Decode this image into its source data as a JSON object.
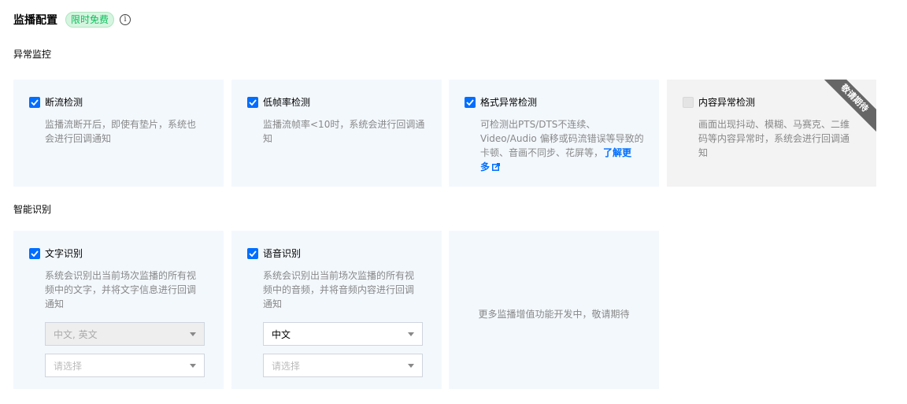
{
  "header": {
    "title": "监播配置",
    "badge": "限时免费",
    "info_symbol": "i"
  },
  "sections": {
    "abnormal": "异常监控",
    "smart": "智能识别"
  },
  "cards": {
    "stream_cut": {
      "label": "断流检测",
      "checked": true,
      "desc": [
        "监播流断开后，即使有垫片，系统也",
        "会进行回调通知"
      ]
    },
    "low_fps": {
      "label": "低帧率检测",
      "checked": true,
      "desc": [
        "监播流帧率<10时，系统会进行回调通",
        "知"
      ]
    },
    "format": {
      "label": "格式异常检测",
      "checked": true,
      "desc": [
        "可检测出PTS/DTS不连续、",
        "Video/Audio 偏移或码流错误等导致的",
        "卡顿、音画不同步、花屏等，"
      ],
      "link_1": "了解更",
      "link_2": "多"
    },
    "content": {
      "label": "内容异常检测",
      "checked": false,
      "desc": [
        "画面出现抖动、模糊、马赛克、二维",
        "码等内容异常时，系统会进行回调通",
        "知"
      ],
      "ribbon": "敬请期待"
    },
    "text_ocr": {
      "label": "文字识别",
      "checked": true,
      "desc": [
        "系统会识别出当前场次监播的所有视",
        "频中的文字，并将文字信息进行回调",
        "通知"
      ],
      "select_1": "中文, 英文",
      "select_2_placeholder": "请选择"
    },
    "speech": {
      "label": "语音识别",
      "checked": true,
      "desc": [
        "系统会识别出当前场次监播的所有视",
        "频中的音频，并将音频内容进行回调",
        "通知"
      ],
      "select_1": "中文",
      "select_2_placeholder": "请选择"
    },
    "more": {
      "text": "更多监播增值功能开发中，敬请期待"
    }
  },
  "colors": {
    "accent": "#006eff",
    "card_bg": "#f3f8fd",
    "badge_green": "#0abf5b"
  }
}
